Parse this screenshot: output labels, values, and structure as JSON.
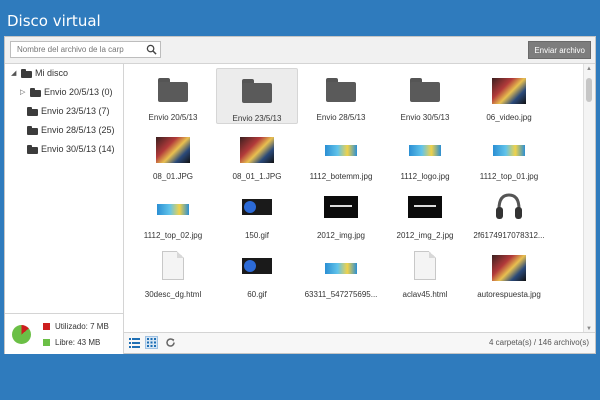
{
  "app_title": "Disco virtual",
  "search": {
    "placeholder": "Nombre del archivo de la carp"
  },
  "upload_label": "Enviar archivo",
  "tree": {
    "root": "Mi disco",
    "items": [
      {
        "label": "Envio 20/5/13 (0)"
      },
      {
        "label": "Envio 23/5/13 (7)"
      },
      {
        "label": "Envio 28/5/13 (25)"
      },
      {
        "label": "Envio 30/5/13 (14)"
      }
    ]
  },
  "usage": {
    "used_label": "Utilizado: 7 MB",
    "free_label": "Libre: 43 MB",
    "used_fraction": 0.14,
    "used_color": "#cc1e1e",
    "free_color": "#6bbf46"
  },
  "files": [
    {
      "name": "Envio 20/5/13",
      "kind": "folder"
    },
    {
      "name": "Envio 23/5/13",
      "kind": "folder",
      "selected": true
    },
    {
      "name": "Envio 28/5/13",
      "kind": "folder"
    },
    {
      "name": "Envio 30/5/13",
      "kind": "folder"
    },
    {
      "name": "06_video.jpg",
      "kind": "photo"
    },
    {
      "name": "08_01.JPG",
      "kind": "photo"
    },
    {
      "name": "08_01_1.JPG",
      "kind": "photo"
    },
    {
      "name": "1112_botemm.jpg",
      "kind": "banner"
    },
    {
      "name": "1112_logo.jpg",
      "kind": "banner"
    },
    {
      "name": "1112_top_01.jpg",
      "kind": "banner"
    },
    {
      "name": "1112_top_02.jpg",
      "kind": "banner"
    },
    {
      "name": "150.gif",
      "kind": "logo"
    },
    {
      "name": "2012_img.jpg",
      "kind": "dark"
    },
    {
      "name": "2012_img_2.jpg",
      "kind": "dark"
    },
    {
      "name": "2f6174917078312...",
      "kind": "headphones"
    },
    {
      "name": "30desc_dg.html",
      "kind": "doc"
    },
    {
      "name": "60.gif",
      "kind": "logo"
    },
    {
      "name": "63311_547275695...",
      "kind": "banner"
    },
    {
      "name": "aclav45.html",
      "kind": "doc"
    },
    {
      "name": "autorespuesta.jpg",
      "kind": "photo"
    }
  ],
  "status": "4 carpeta(s) / 146 archivo(s)"
}
